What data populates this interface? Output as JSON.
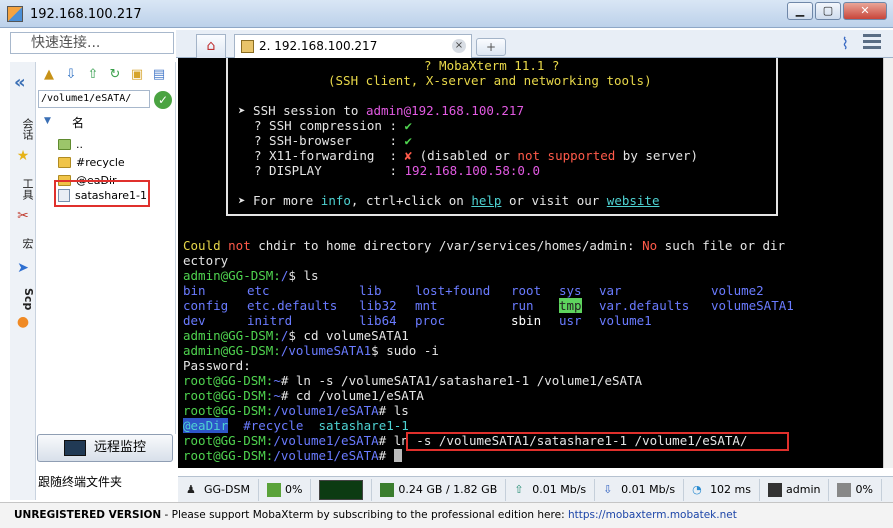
{
  "window": {
    "title": "192.168.100.217",
    "min": "▁",
    "max": "▢",
    "close": "✕"
  },
  "quick_connect": {
    "placeholder": "快速连接..."
  },
  "tab": {
    "label": "2. 192.168.100.217",
    "close": "×",
    "new_tab": "+"
  },
  "side_tabs": {
    "sessions": "会话",
    "tools": "工具",
    "macros": "宏",
    "sftp": "Scp"
  },
  "file_panel": {
    "path": "/volume1/eSATA/",
    "column_name": "名",
    "items": [
      {
        "name": "..",
        "type": "parent"
      },
      {
        "name": "#recycle",
        "type": "folder"
      },
      {
        "name": "@eaDir",
        "type": "folder"
      },
      {
        "name": "satashare1-1",
        "type": "link"
      }
    ]
  },
  "remote_monitor": {
    "label": "远程监控"
  },
  "follow_terminal": {
    "label": "跟随终端文件夹"
  },
  "banner": {
    "title": "? MobaXterm 11.1 ?",
    "subtitle": "(SSH client, X-server and networking tools)",
    "ssh_prefix": "➤ SSH session to ",
    "user": "admin",
    "host": "@192.168.100.217",
    "compression": "? SSH compression : ",
    "browser": "? SSH-browser     : ",
    "x11": "? X11-forwarding  : ",
    "display": "? DISPLAY         : ",
    "check": "✔",
    "cross": "✘",
    "x11_a": " (disabled ",
    "x11_or": "or",
    "x11_b": " not",
    "x11_c": " supported",
    "x11_d": " by server)",
    "display_val": "192.168.100.58:0.0",
    "more_a": "➤ For more ",
    "more_info": "info",
    "more_b": ", ctrl+click on ",
    "more_help": "help",
    "more_c": " or visit our ",
    "more_site": "website"
  },
  "terminal": {
    "l1a": "Could ",
    "l1b": "not",
    "l1c": " chdir to home directory /var/services/homes/admin: ",
    "l1d": "No",
    "l1e": " such file or dir",
    "l2": "ectory",
    "p_admin_home": "admin@GG-DSM:",
    "p_home_path": "/",
    "p_tail_dollar": "$ ",
    "cmd_ls": "ls",
    "ls1": [
      "bin",
      "etc",
      "lib",
      "lost+found",
      "root",
      "sys",
      "var",
      "volume2"
    ],
    "ls2": [
      "config",
      "etc.defaults",
      "lib32",
      "mnt",
      "run",
      "tmp",
      "var.defaults",
      "volumeSATA1"
    ],
    "ls3": [
      "dev",
      "initrd",
      "lib64",
      "proc",
      "sbin",
      "usr",
      "volume1"
    ],
    "cmd_cd_sata": "cd volumeSATA1",
    "p_sata_path": "/volumeSATA1",
    "cmd_sudo": "sudo -i",
    "password": "Password:",
    "p_root": "root@GG-DSM:",
    "p_tilde": "~",
    "p_hash": "# ",
    "cmd_ln": "ln -s /volumeSATA1/satashare1-1 /volume1/eSATA",
    "cmd_cd_esata": "cd /volume1/eSATA",
    "p_esata_path": "/volume1/eSATA",
    "cmd_ls2": "ls",
    "ls_esata": [
      "@eaDir",
      "#recycle",
      "satashare1-1"
    ],
    "cmd_ln2": "ln -s /volumeSATA1/satashare1-1 /volume1/eSATA/"
  },
  "status": {
    "host": "GG-DSM",
    "cpu": "0%",
    "memory": "0.24 GB / 1.82 GB",
    "upload": "0.01 Mb/s",
    "download": "0.01 Mb/s",
    "time": "102 ms",
    "user": "admin",
    "disk": "0%"
  },
  "footer": {
    "unreg": "UNREGISTERED VERSION",
    "msg": "  -  Please support MobaXterm by subscribing to the professional edition here: ",
    "url": "https://mobaxterm.mobatek.net"
  }
}
